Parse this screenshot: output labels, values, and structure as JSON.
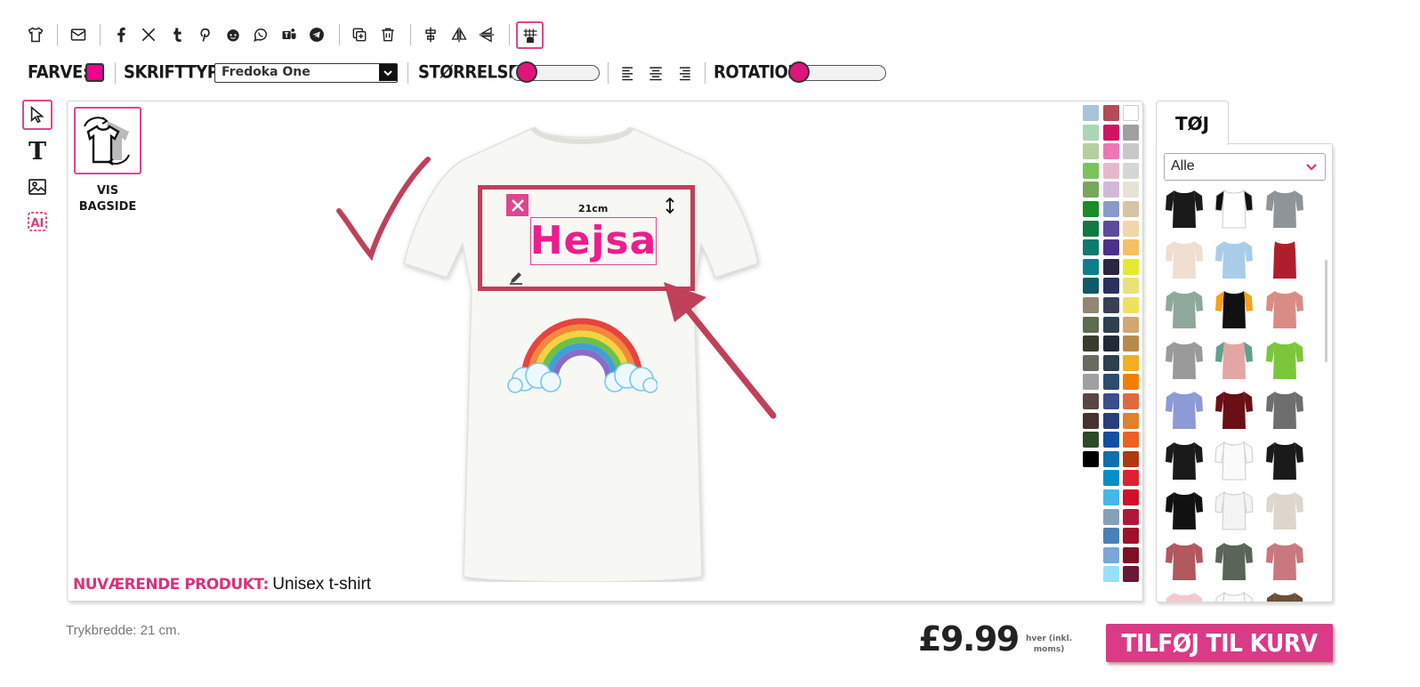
{
  "toolbar": {
    "icons": [
      "tshirt-icon",
      "mail-icon",
      "facebook-icon",
      "x-icon",
      "tumblr-icon",
      "pinterest-icon",
      "reddit-icon",
      "whatsapp-icon",
      "teams-icon",
      "telegram-icon",
      "duplicate-icon",
      "trash-icon",
      "align-center-icon",
      "flip-horizontal-icon",
      "flip-vertical-icon",
      "grid-snap-icon"
    ]
  },
  "options": {
    "color_label": "FARVE:",
    "color_value": "#ec008c",
    "font_label": "SKRIFTTYPE:",
    "font_value": "Fredoka One",
    "size_label": "STØRRELSE:",
    "size_level": 0.08,
    "rotation_label": "ROTATION:",
    "rotation_level": 0.05
  },
  "side_tools": [
    "select-icon",
    "text-icon",
    "image-icon",
    "ai-icon"
  ],
  "canvas": {
    "back_button_label_1": "VIS",
    "back_button_label_2": "BAGSIDE",
    "text_object": "Hejsa",
    "width_label": "21cm",
    "current_product_label": "NUVÆRENDE PRODUKT:",
    "current_product_value": "Unisex t-shirt",
    "colors_col1": [
      "#a8c4d6",
      "#a9d7b6",
      "#b5cf9e",
      "#7ec35a",
      "#77a85a",
      "#1a8c2a",
      "#117a44",
      "#0e7a6b",
      "#0a7f8c",
      "#0f5a66",
      "#8f8770",
      "#5e6b4f",
      "#3a3a2e",
      "#6a6a62",
      "#a0a0a0",
      "#5a4545",
      "#4a3030",
      "#2d4a2a",
      "#000000"
    ],
    "colors_col2": [
      "#b24b5a",
      "#d01464",
      "#ee76b4",
      "#e7b8cc",
      "#d2b8d8",
      "#8a9ac8",
      "#5a4c9a",
      "#4b3187",
      "#2c2640",
      "#2c3060",
      "#3a3f55",
      "#2e4050",
      "#232a36",
      "#2e3f4e",
      "#2e4c6e",
      "#3b4d8b",
      "#2a3e7a",
      "#1050a0",
      "#1070b0",
      "#0090c8",
      "#40b8e8",
      "#86a0b8",
      "#4a80b8",
      "#78a8d8",
      "#98e0f8"
    ],
    "colors_col3": [
      "#ffffff",
      "#a0a0a0",
      "#c8c8c8",
      "#d6d6d6",
      "#e6e2d6",
      "#d8c4a4",
      "#f2d8a8",
      "#f4c060",
      "#e6e830",
      "#ece07a",
      "#f0e060",
      "#d0a870",
      "#b88a4a",
      "#f0b020",
      "#f08000",
      "#e06a40",
      "#e08030",
      "#f06020",
      "#b03a10",
      "#e02030",
      "#d01028",
      "#b01838",
      "#a0102a",
      "#801028",
      "#6a1838"
    ]
  },
  "sidebar": {
    "tab_label": "TØJ",
    "filter_value": "Alle"
  },
  "footer": {
    "print_width": "Trykbredde: 21 cm.",
    "price": "£9.99",
    "price_note_1": "hver (inkl.",
    "price_note_2": "moms)",
    "cta_label": "TILFØJ TIL KURV"
  }
}
